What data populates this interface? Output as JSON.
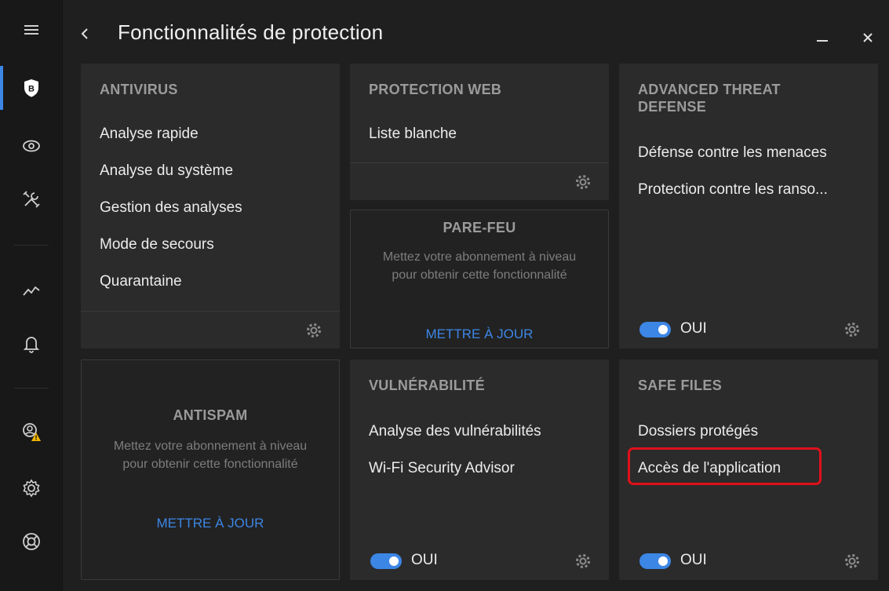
{
  "header": {
    "title": "Fonctionnalités de protection"
  },
  "sidebar": {
    "items": [
      {
        "icon": "menu-icon"
      },
      {
        "icon": "bitdefender-shield-icon",
        "badge": "B",
        "active": true
      },
      {
        "icon": "eye-icon"
      },
      {
        "icon": "tools-icon"
      },
      {
        "icon": "activity-icon"
      },
      {
        "icon": "bell-icon"
      },
      {
        "icon": "account-warning-icon"
      },
      {
        "icon": "gear-icon"
      },
      {
        "icon": "lifebuoy-icon"
      }
    ]
  },
  "cards": {
    "antivirus": {
      "title": "ANTIVIRUS",
      "links": [
        "Analyse rapide",
        "Analyse du système",
        "Gestion des analyses",
        "Mode de secours",
        "Quarantaine"
      ]
    },
    "web": {
      "title": "PROTECTION WEB",
      "links": [
        "Liste blanche"
      ]
    },
    "firewall": {
      "title": "PARE-FEU",
      "message": "Mettez votre abonnement à niveau pour obtenir cette fonctionnalité",
      "action": "METTRE À JOUR"
    },
    "atd": {
      "title": "ADVANCED THREAT DEFENSE",
      "links": [
        "Défense contre les menaces",
        "Protection contre les ranso..."
      ],
      "toggle_label": "OUI"
    },
    "antispam": {
      "title": "ANTISPAM",
      "message": "Mettez votre abonnement à niveau pour obtenir cette fonctionnalité",
      "action": "METTRE À JOUR"
    },
    "vuln": {
      "title": "VULNÉRABILITÉ",
      "links": [
        "Analyse des vulnérabilités",
        "Wi-Fi Security Advisor"
      ],
      "toggle_label": "OUI"
    },
    "safefiles": {
      "title": "SAFE FILES",
      "links": [
        "Dossiers protégés",
        "Accès de l'application"
      ],
      "toggle_label": "OUI"
    }
  },
  "colors": {
    "accent": "#3c86e6",
    "highlight": "#e0101a",
    "warning": "#f2b705"
  }
}
